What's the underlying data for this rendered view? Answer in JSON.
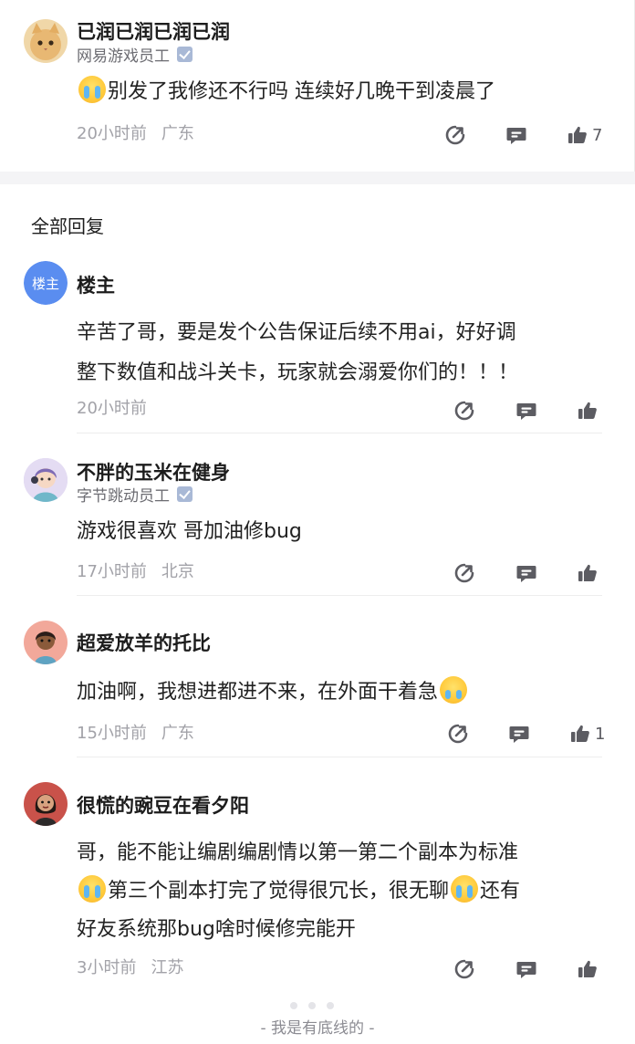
{
  "post": {
    "username": "已润已润已润已润",
    "role": "网易游戏员工",
    "text": "别发了我修还不行吗 连续好几晚干到凌晨了",
    "time": "20小时前",
    "location": "广东",
    "likes": "7"
  },
  "section_title": "全部回复",
  "replies": [
    {
      "username": "楼主",
      "avatar_label": "楼主",
      "lines": [
        "辛苦了哥，要是发个公告保证后续不用ai，好好调",
        "整下数值和战斗关卡，玩家就会溺爱你们的！！！"
      ],
      "time": "20小时前",
      "location": "",
      "likes": ""
    },
    {
      "username": "不胖的玉米在健身",
      "role": "字节跳动员工",
      "lines": [
        "游戏很喜欢 哥加油修bug"
      ],
      "time": "17小时前",
      "location": "北京",
      "likes": ""
    },
    {
      "username": "超爱放羊的托比",
      "lines": [
        "加油啊，我想进都进不来，在外面干着急"
      ],
      "time": "15小时前",
      "location": "广东",
      "likes": "1"
    },
    {
      "username": "很慌的豌豆在看夕阳",
      "lines": [
        "哥，能不能让编剧编剧情以第一第二个副本为标准",
        "第三个副本打完了觉得很冗长，很无聊",
        "还有",
        "好友系统那bug啥时候修完能开"
      ],
      "time": "3小时前",
      "location": "江苏",
      "likes": ""
    }
  ],
  "footer": "- 我是有底线的 -",
  "icons": {
    "share": "share-icon",
    "comment": "comment-icon",
    "like": "thumbs-up-icon",
    "verified": "verified-badge-icon",
    "emoji_cry": "loudly-crying-emoji",
    "emoji_laugh": "tears-of-joy-emoji"
  },
  "colors": {
    "accent_blue": "#5a8df0",
    "muted_text": "#a2a2a8",
    "divider": "#ededed"
  }
}
